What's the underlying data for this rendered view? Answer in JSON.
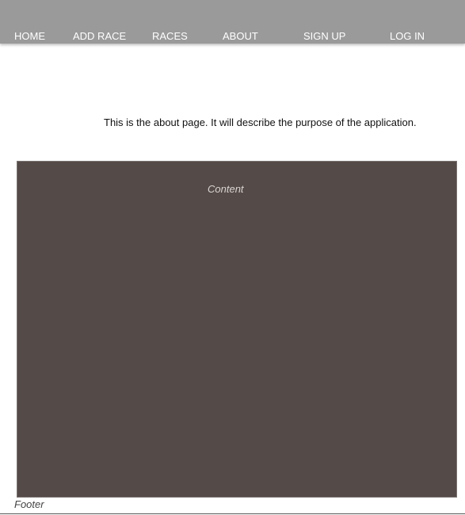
{
  "nav": {
    "items": [
      {
        "label": "HOME"
      },
      {
        "label": "ADD RACE"
      },
      {
        "label": "RACES"
      },
      {
        "label": "ABOUT"
      },
      {
        "label": "SIGN UP"
      },
      {
        "label": "LOG IN"
      }
    ]
  },
  "main": {
    "description": "This is the about page. It will describe the purpose of the application.",
    "content_label": "Content"
  },
  "footer": {
    "label": "Footer"
  },
  "colors": {
    "navbar_bg": "#9a9a9a",
    "nav_text": "#ffffff",
    "content_bg": "#544b48",
    "page_bg": "#ffffff"
  }
}
